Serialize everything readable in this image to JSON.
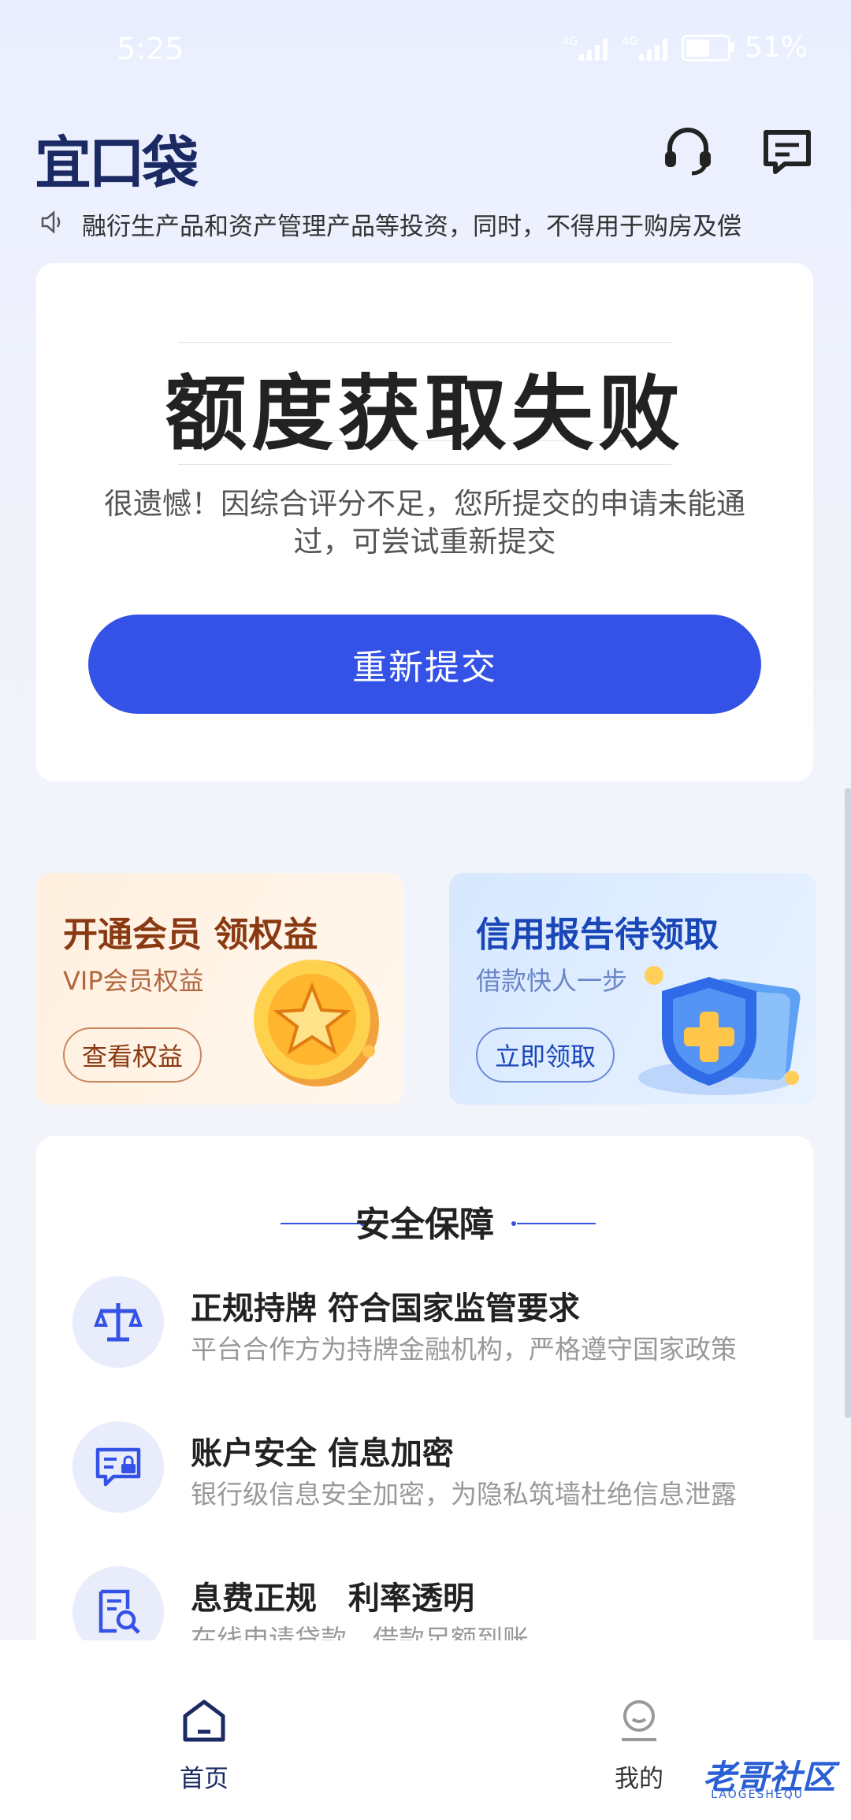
{
  "status_bar": {
    "time": "5:25",
    "network1": "4G",
    "network2": "4G",
    "battery": "51%",
    "battery_level": 0.51
  },
  "header": {
    "logo": "宜口袋",
    "support_icon": "headset-icon",
    "message_icon": "message-icon"
  },
  "notice": {
    "icon": "speaker-icon",
    "text": "融衍生产品和资产管理产品等投资，同时，不得用于购房及偿"
  },
  "result": {
    "title": "额度获取失败",
    "description": "很遗憾！因综合评分不足，您所提交的申请未能通过，可尝试重新提交",
    "button": "重新提交"
  },
  "promos": [
    {
      "title": "开通会员 领权益",
      "subtitle": "VIP会员权益",
      "button": "查看权益"
    },
    {
      "title": "信用报告待领取",
      "subtitle": "借款快人一步",
      "button": "立即领取"
    }
  ],
  "safety": {
    "title": "安全保障",
    "items": [
      {
        "icon": "scale-icon",
        "title": "正规持牌 符合国家监管要求",
        "desc": "平台合作方为持牌金融机构，严格遵守国家政策"
      },
      {
        "icon": "secure-message-icon",
        "title": "账户安全 信息加密",
        "desc": "银行级信息安全加密，为隐私筑墙杜绝信息泄露"
      },
      {
        "icon": "document-search-icon",
        "title": "息费正规　利率透明",
        "desc": "在线申请贷款，借款足额到账"
      }
    ]
  },
  "nav": {
    "home": "首页",
    "mine": "我的"
  },
  "watermark": {
    "text": "老哥社区",
    "sub": "LAOGESHEQU"
  },
  "colors": {
    "primary": "#3552e6",
    "navy": "#1b2a63"
  }
}
